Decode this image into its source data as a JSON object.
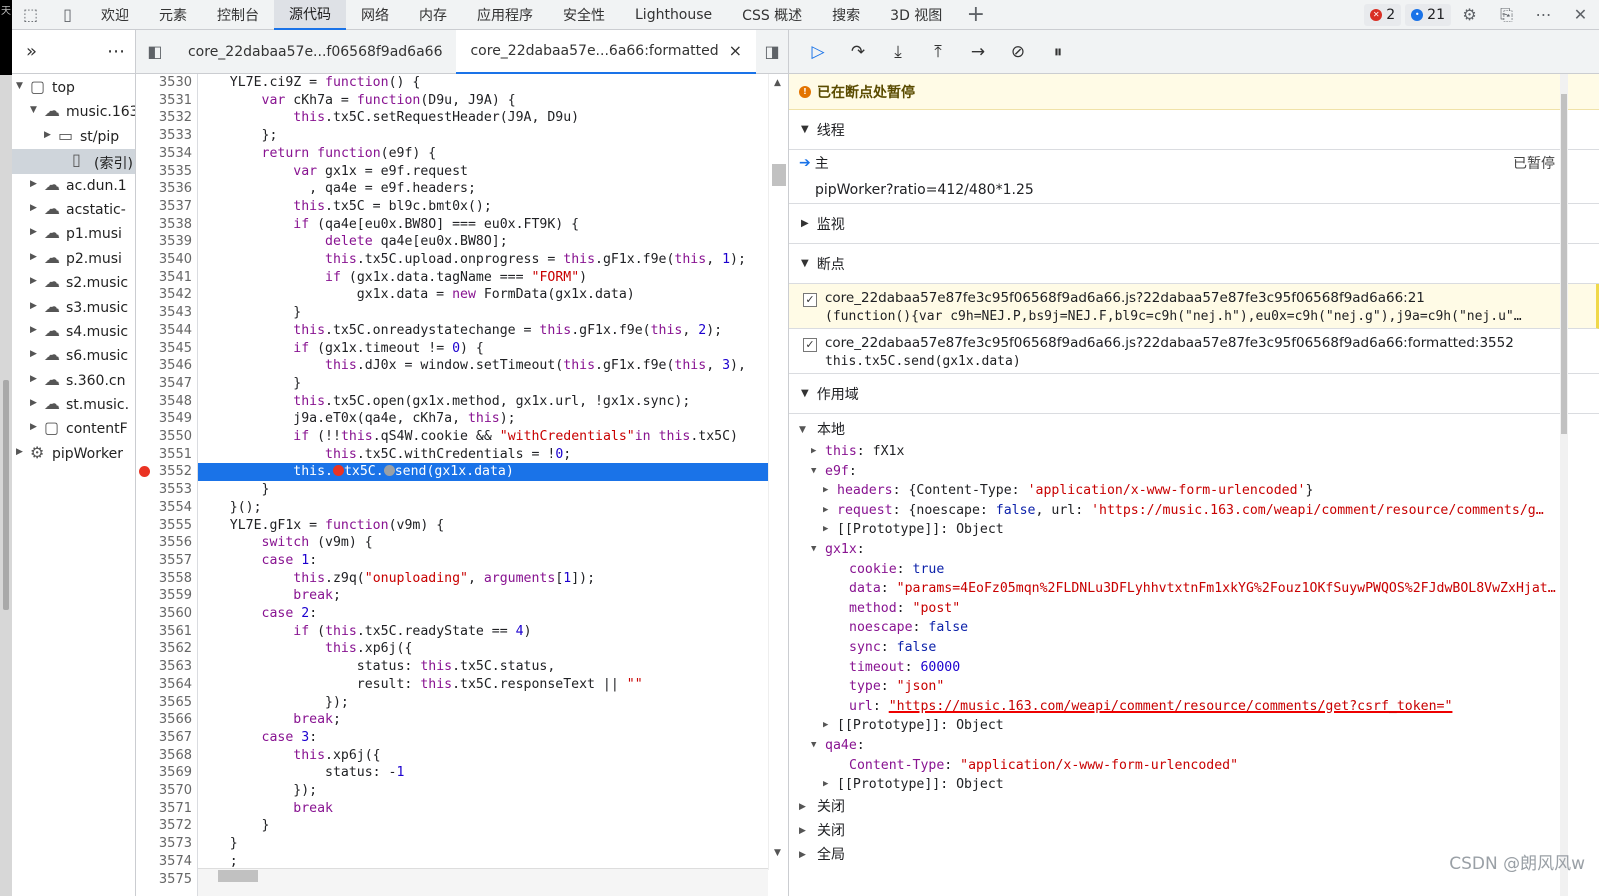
{
  "topbar": {
    "tabs": [
      "欢迎",
      "元素",
      "控制台",
      "源代码",
      "网络",
      "内存",
      "应用程序",
      "安全性",
      "Lighthouse",
      "CSS 概述",
      "搜索",
      "3D 视图"
    ],
    "active_tab": 3,
    "error_count": "2",
    "message_count": "21"
  },
  "navigator": {
    "items": [
      {
        "label": "top",
        "icon": "frame-icon",
        "indent": 1,
        "arrow": "▼"
      },
      {
        "label": "music.163",
        "icon": "cloud-icon",
        "indent": 2,
        "arrow": "▼"
      },
      {
        "label": "st/pip",
        "icon": "folder-icon",
        "indent": 3,
        "arrow": "▶"
      },
      {
        "label": "(索引)",
        "icon": "file-icon",
        "indent": 4,
        "arrow": "",
        "selected": true
      },
      {
        "label": "ac.dun.1",
        "icon": "cloud-icon",
        "indent": 2,
        "arrow": "▶"
      },
      {
        "label": "acstatic-",
        "icon": "cloud-icon",
        "indent": 2,
        "arrow": "▶"
      },
      {
        "label": "p1.musi",
        "icon": "cloud-icon",
        "indent": 2,
        "arrow": "▶"
      },
      {
        "label": "p2.musi",
        "icon": "cloud-icon",
        "indent": 2,
        "arrow": "▶"
      },
      {
        "label": "s2.music",
        "icon": "cloud-icon",
        "indent": 2,
        "arrow": "▶"
      },
      {
        "label": "s3.music",
        "icon": "cloud-icon",
        "indent": 2,
        "arrow": "▶"
      },
      {
        "label": "s4.music",
        "icon": "cloud-icon",
        "indent": 2,
        "arrow": "▶"
      },
      {
        "label": "s6.music",
        "icon": "cloud-icon",
        "indent": 2,
        "arrow": "▶"
      },
      {
        "label": "s.360.cn",
        "icon": "cloud-icon",
        "indent": 2,
        "arrow": "▶"
      },
      {
        "label": "st.music.",
        "icon": "cloud-icon",
        "indent": 2,
        "arrow": "▶"
      },
      {
        "label": "contentF",
        "icon": "frame-icon",
        "indent": 2,
        "arrow": "▶"
      },
      {
        "label": "pipWorker",
        "icon": "gear-file-icon",
        "indent": 1,
        "arrow": "▶"
      }
    ]
  },
  "editor": {
    "file_tabs": [
      {
        "label": "core_22dabaa57e...f06568f9ad6a66",
        "active": false
      },
      {
        "label": "core_22dabaa57e...6a66:formatted",
        "active": true
      }
    ],
    "close_glyph": "×",
    "breakpoint_line": 3552,
    "lines": [
      {
        "n": 3530,
        "html": "    YL7E.ci9Z = <span class='pk'>function</span>() {"
      },
      {
        "n": 3531,
        "html": "        <span class='pk'>var</span> cKh7a = <span class='pk'>function</span>(D9u, J9A) {"
      },
      {
        "n": 3532,
        "html": "            <span class='pk'>this</span>.tx5C.setRequestHeader(J9A, D9u)"
      },
      {
        "n": 3533,
        "html": "        };"
      },
      {
        "n": 3534,
        "html": "        <span class='pk'>return</span> <span class='pk'>function</span>(e9f) {"
      },
      {
        "n": 3535,
        "html": "            <span class='pk'>var</span> gx1x = e9f.request"
      },
      {
        "n": 3536,
        "html": "              , qa4e = e9f.headers;"
      },
      {
        "n": 3537,
        "html": "            <span class='pk'>this</span>.tx5C = bl9c.bmt0x();"
      },
      {
        "n": 3538,
        "html": "            <span class='pk'>if</span> (qa4e[eu0x.BW8O] === eu0x.FT9K) {"
      },
      {
        "n": 3539,
        "html": "                <span class='pk'>delete</span> qa4e[eu0x.BW8O];"
      },
      {
        "n": 3540,
        "html": "                <span class='pk'>this</span>.tx5C.upload.onprogress = <span class='pk'>this</span>.gF1x.f9e(<span class='pk'>this</span>, <span class='pn'>1</span>);"
      },
      {
        "n": 3541,
        "html": "                <span class='pk'>if</span> (gx1x.data.tagName === <span class='ps'>\"FORM\"</span>)"
      },
      {
        "n": 3542,
        "html": "                    gx1x.data = <span class='pk'>new</span> FormData(gx1x.data)"
      },
      {
        "n": 3543,
        "html": "            }"
      },
      {
        "n": 3544,
        "html": "            <span class='pk'>this</span>.tx5C.onreadystatechange = <span class='pk'>this</span>.gF1x.f9e(<span class='pk'>this</span>, <span class='pn'>2</span>);"
      },
      {
        "n": 3545,
        "html": "            <span class='pk'>if</span> (gx1x.timeout != <span class='pn'>0</span>) {"
      },
      {
        "n": 3546,
        "html": "                <span class='pk'>this</span>.dJ0x = window.setTimeout(<span class='pk'>this</span>.gF1x.f9e(<span class='pk'>this</span>, <span class='pn'>3</span>),"
      },
      {
        "n": 3547,
        "html": "            }"
      },
      {
        "n": 3548,
        "html": "            <span class='pk'>this</span>.tx5C.open(gx1x.method, gx1x.url, !gx1x.sync);"
      },
      {
        "n": 3549,
        "html": "            j9a.eT0x(qa4e, cKh7a, <span class='pk'>this</span>);"
      },
      {
        "n": 3550,
        "html": "            <span class='pk'>if</span> (!!<span class='pk'>this</span>.qS4W.cookie &amp;&amp; <span class='ps'>\"withCredentials\"</span><span class='pk'>in</span> <span class='pk'>this</span>.tx5C)"
      },
      {
        "n": 3551,
        "html": "                <span class='pk'>this</span>.tx5C.withCredentials = !<span class='pn'>0</span>;"
      },
      {
        "n": 3552,
        "html": "            this.<span style='display:inline-block;width:11px;height:11px;border-radius:50%;background:#ea3323;vertical-align:-1px'></span>tx5C.<span style='display:inline-block;width:11px;height:11px;border-radius:50%;background:#9aa0a6;vertical-align:-1px'></span>send(gx1x.data)"
      },
      {
        "n": 3553,
        "html": "        }"
      },
      {
        "n": 3554,
        "html": "    }();"
      },
      {
        "n": 3555,
        "html": "    YL7E.gF1x = <span class='pk'>function</span>(v9m) {"
      },
      {
        "n": 3556,
        "html": "        <span class='pk'>switch</span> (v9m) {"
      },
      {
        "n": 3557,
        "html": "        <span class='pk'>case</span> <span class='pn'>1</span>:"
      },
      {
        "n": 3558,
        "html": "            <span class='pk'>this</span>.z9q(<span class='ps'>\"onuploading\"</span>, <span class='pk'>arguments</span>[<span class='pn'>1</span>]);"
      },
      {
        "n": 3559,
        "html": "            <span class='pk'>break</span>;"
      },
      {
        "n": 3560,
        "html": "        <span class='pk'>case</span> <span class='pn'>2</span>:"
      },
      {
        "n": 3561,
        "html": "            <span class='pk'>if</span> (<span class='pk'>this</span>.tx5C.readyState == <span class='pn'>4</span>)"
      },
      {
        "n": 3562,
        "html": "                <span class='pk'>this</span>.xp6j({"
      },
      {
        "n": 3563,
        "html": "                    status: <span class='pk'>this</span>.tx5C.status,"
      },
      {
        "n": 3564,
        "html": "                    result: <span class='pk'>this</span>.tx5C.responseText || <span class='ps'>\"\"</span>"
      },
      {
        "n": 3565,
        "html": "                });"
      },
      {
        "n": 3566,
        "html": "            <span class='pk'>break</span>;"
      },
      {
        "n": 3567,
        "html": "        <span class='pk'>case</span> <span class='pn'>3</span>:"
      },
      {
        "n": 3568,
        "html": "            <span class='pk'>this</span>.xp6j({"
      },
      {
        "n": 3569,
        "html": "                status: -<span class='pn'>1</span>"
      },
      {
        "n": 3570,
        "html": "            });"
      },
      {
        "n": 3571,
        "html": "            <span class='pk'>break</span>"
      },
      {
        "n": 3572,
        "html": "        }"
      },
      {
        "n": 3573,
        "html": "    }"
      },
      {
        "n": 3574,
        "html": "    ;"
      },
      {
        "n": 3575,
        "html": ""
      }
    ]
  },
  "debugger": {
    "paused_text": "已在断点处暂停",
    "threads_label": "线程",
    "thread_main": "主",
    "thread_status": "已暂停",
    "thread_worker": "pipWorker?ratio=412/480*1.25",
    "watch_label": "监视",
    "breakpoints_label": "断点",
    "breakpoints": [
      {
        "file": "core_22dabaa57e87fe3c95f06568f9ad6a66.js?22dabaa57e87fe3c95f06568f9ad6a66:21",
        "code": "(function(){var c9h=NEJ.P,bs9j=NEJ.F,bl9c=c9h(\"nej.h\"),eu0x=c9h(\"nej.g\"),j9a=c9h(\"nej.u\"…",
        "hl": true
      },
      {
        "file": "core_22dabaa57e87fe3c95f06568f9ad6a66.js?22dabaa57e87fe3c95f06568f9ad6a66:formatted:3552",
        "code": "this.tx5C.send(gx1x.data)",
        "hl": false
      }
    ],
    "scope_label": "作用域",
    "local_label": "本地",
    "closure_label": "关闭",
    "global_label": "全局",
    "scope": [
      {
        "i": 1,
        "a": "▶",
        "html": "<span class='pk'>this</span>: fX1x"
      },
      {
        "i": 1,
        "a": "▼",
        "html": "<span class='pk'>e9f</span>:"
      },
      {
        "i": 2,
        "a": "▶",
        "html": "<span class='pk'>headers</span>: {Content-Type: <span class='ps'>'application/x-www-form-urlencoded'</span>}"
      },
      {
        "i": 2,
        "a": "▶",
        "html": "<span class='pk'>request</span>: {noescape: <span class='pb'>false</span>, url: <span class='ps'>'https://music.163.com/weapi/comment/resource/comments/g…</span>"
      },
      {
        "i": 2,
        "a": "▶",
        "html": "[[Prototype]]: Object"
      },
      {
        "i": 1,
        "a": "▼",
        "html": "<span class='pk'>gx1x</span>:"
      },
      {
        "i": 3,
        "a": "",
        "html": "<span class='pk'>cookie</span>: <span class='pb'>true</span>"
      },
      {
        "i": 3,
        "a": "",
        "html": "<span class='pk'>data</span>: <span class='ps'>\"params=4EoFz05mqn%2FLDNLu3DFLyhhvtxtnFm1xkYG%2Fouz1OKfSuywPWQOS%2FJdwBOL8VwZxHjat…</span>"
      },
      {
        "i": 3,
        "a": "",
        "html": "<span class='pk'>method</span>: <span class='ps'>\"post\"</span>"
      },
      {
        "i": 3,
        "a": "",
        "html": "<span class='pk'>noescape</span>: <span class='pb'>false</span>"
      },
      {
        "i": 3,
        "a": "",
        "html": "<span class='pk'>sync</span>: <span class='pb'>false</span>"
      },
      {
        "i": 3,
        "a": "",
        "html": "<span class='pk'>timeout</span>: <span class='pn'>60000</span>"
      },
      {
        "i": 3,
        "a": "",
        "html": "<span class='pk'>type</span>: <span class='ps'>\"json\"</span>"
      },
      {
        "i": 3,
        "a": "",
        "html": "<span class='pk'>url</span>: <span class='ps' style='text-decoration:underline;text-decoration-color:#e00;text-decoration-thickness:2px'>\"https://music.163.com/weapi/comment/resource/comments/get?csrf_token=\"</span>"
      },
      {
        "i": 2,
        "a": "▶",
        "html": "[[Prototype]]: Object"
      },
      {
        "i": 1,
        "a": "▼",
        "html": "<span class='pk'>qa4e</span>:"
      },
      {
        "i": 3,
        "a": "",
        "html": "<span class='pk'>Content-Type</span>: <span class='ps'>\"application/x-www-form-urlencoded\"</span>"
      },
      {
        "i": 2,
        "a": "▶",
        "html": "[[Prototype]]: Object"
      }
    ]
  },
  "watermark": "CSDN @朗风风w"
}
